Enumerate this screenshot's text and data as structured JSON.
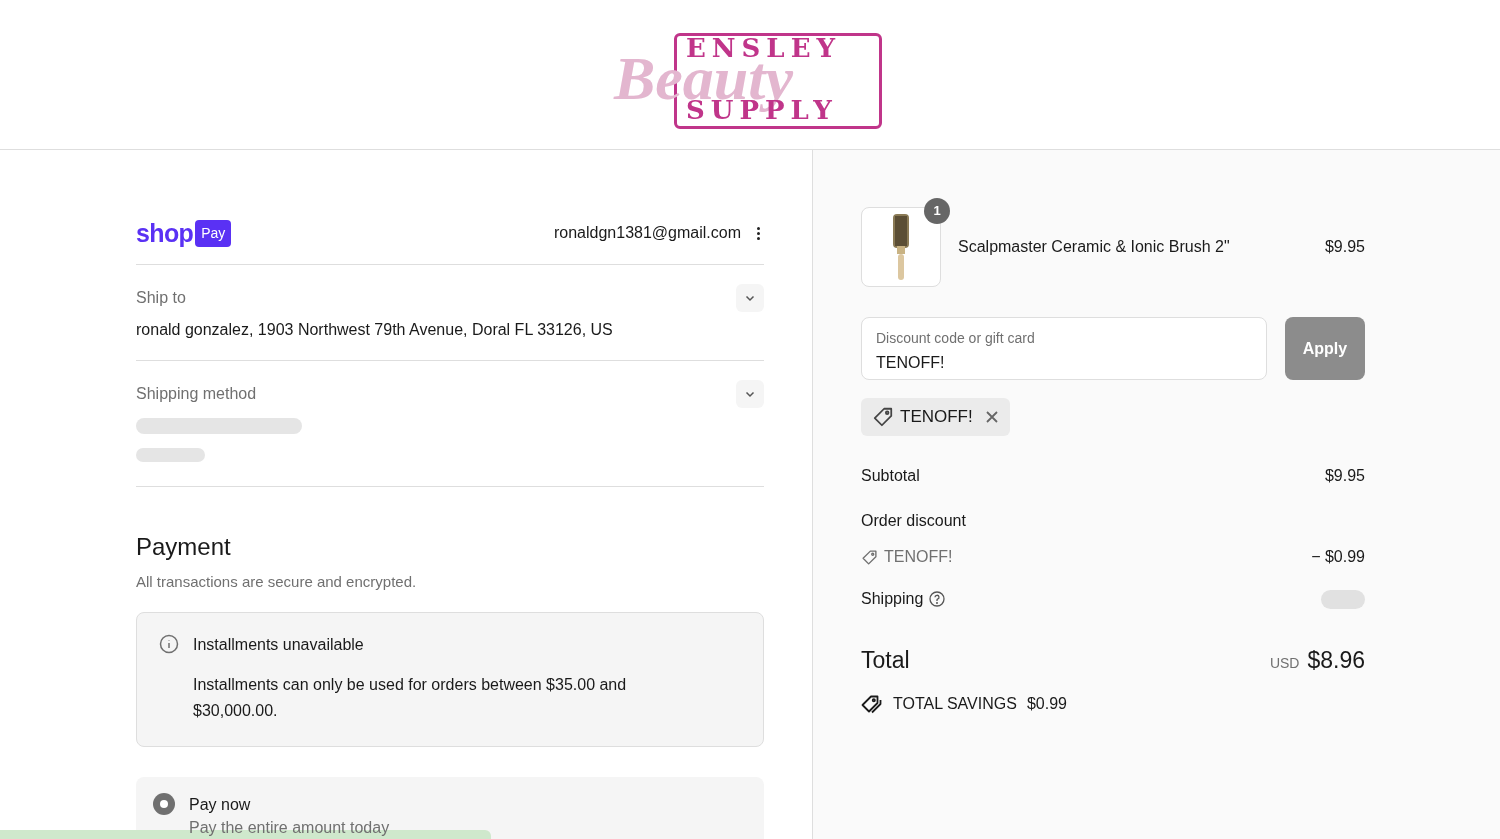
{
  "logo": {
    "top": "ENSLEY",
    "script": "Beauty",
    "bottom": "SUPPLY"
  },
  "express": {
    "brand": "shop",
    "badge": "Pay",
    "email": "ronaldgn1381@gmail.com"
  },
  "sections": [
    {
      "label": "Ship to",
      "value": "ronald gonzalez, 1903 Northwest 79th Avenue, Doral FL 33126, US"
    },
    {
      "label": "Shipping method",
      "loading": true
    }
  ],
  "payment": {
    "title": "Payment",
    "subtitle": "All transactions are secure and encrypted.",
    "notice": {
      "title": "Installments unavailable",
      "body": "Installments can only be used for orders between $35.00 and $30,000.00."
    },
    "options": [
      {
        "label": "Pay now",
        "description": "Pay the entire amount today",
        "selected": true
      }
    ]
  },
  "cart": {
    "items": [
      {
        "quantity": "1",
        "name": "Scalpmaster Ceramic & Ionic Brush 2\"",
        "price": "$9.95"
      }
    ],
    "discount": {
      "placeholder": "Discount code or gift card",
      "value": "TENOFF!",
      "button": "Apply",
      "disabled": true
    },
    "applied_codes": [
      "TENOFF!"
    ],
    "subtotal": {
      "label": "Subtotal",
      "value": "$9.95"
    },
    "order_discount": {
      "label": "Order discount",
      "code": "TENOFF!",
      "value": "− $0.99"
    },
    "shipping": {
      "label": "Shipping",
      "loading": true
    },
    "total": {
      "label": "Total",
      "currency": "USD",
      "value": "$8.96"
    },
    "savings": {
      "label": "TOTAL SAVINGS",
      "value": "$0.99"
    }
  }
}
